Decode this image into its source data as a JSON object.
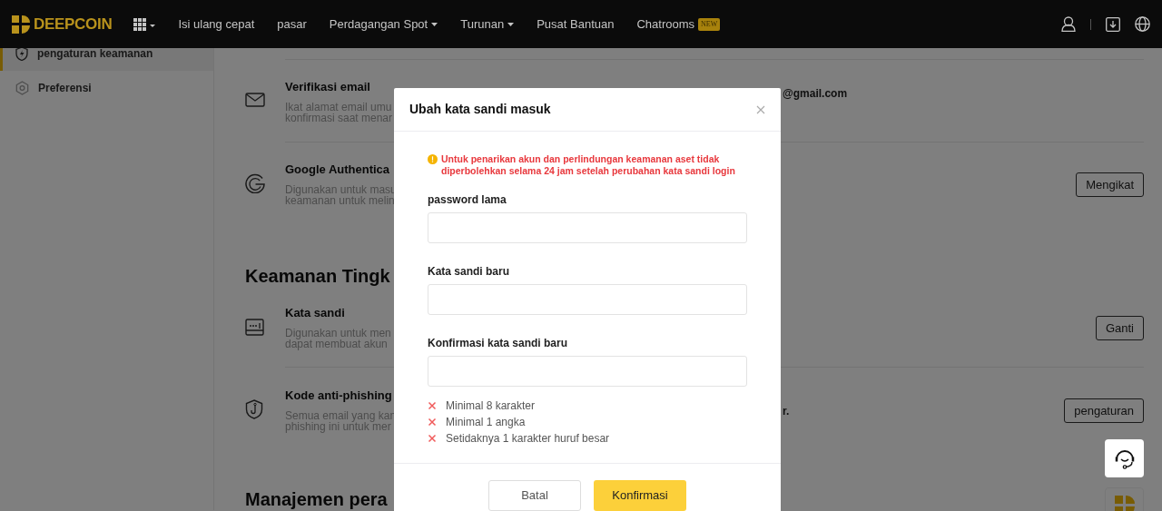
{
  "navbar": {
    "logo": "DEEPCOIN",
    "menu": [
      {
        "label": "Isi ulang cepat",
        "dropdown": false
      },
      {
        "label": "pasar",
        "dropdown": false
      },
      {
        "label": "Perdagangan Spot",
        "dropdown": true
      },
      {
        "label": "Turunan",
        "dropdown": true
      },
      {
        "label": "Pusat Bantuan",
        "dropdown": false
      },
      {
        "label": "Chatrooms",
        "dropdown": false,
        "badge": "NEW"
      }
    ]
  },
  "sidebar": {
    "items": [
      {
        "label": "pengaturan keamanan",
        "selected": true
      },
      {
        "label": "Preferensi",
        "selected": false
      }
    ]
  },
  "sections": [
    {
      "items": [
        {
          "title": "Verifikasi email",
          "description": [
            "Ikat alamat email umu",
            "konfirmasi saat menar"
          ],
          "value": "@gmail.com"
        },
        {
          "title": "Google Authentica",
          "description": [
            "Digunakan untuk masu",
            "keamanan untuk melin"
          ],
          "button": "Mengikat"
        }
      ]
    },
    {
      "heading": "Keamanan Tingk",
      "items": [
        {
          "title": "Kata sandi",
          "description": [
            "Digunakan untuk men",
            "dapat membuat akun"
          ],
          "button": "Ganti"
        },
        {
          "title": "Kode anti-phishing",
          "description": [
            "Semua email yang kan",
            "phishing ini untuk mer"
          ],
          "value": "r.",
          "button": "pengaturan"
        }
      ]
    },
    {
      "heading": "Manajemen pera"
    }
  ],
  "modal": {
    "title": "Ubah kata sandi masuk",
    "warning": "Untuk penarikan akun dan perlindungan keamanan aset tidak diperbolehkan selama 24 jam setelah perubahan kata sandi login",
    "fields": [
      {
        "label": "password lama"
      },
      {
        "label": "Kata sandi baru"
      },
      {
        "label": "Konfirmasi kata sandi baru"
      }
    ],
    "rules": [
      {
        "text": "Minimal 8 karakter",
        "met": false
      },
      {
        "text": "Minimal 1 angka",
        "met": false
      },
      {
        "text": "Setidaknya 1 karakter huruf besar",
        "met": false
      }
    ],
    "cancel": "Batal",
    "confirm": "Konfirmasi"
  }
}
